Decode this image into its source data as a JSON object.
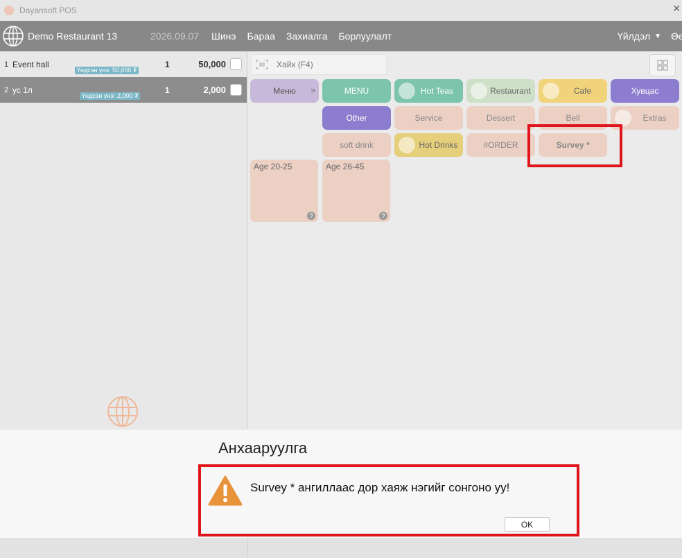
{
  "window": {
    "title": "Dayansoft POS"
  },
  "nav": {
    "restaurant": "Demo Restaurant 13",
    "date": "2026.09.07",
    "items": [
      "Шинэ",
      "Бараа",
      "Захиалга",
      "Борлуулалт"
    ],
    "operations": "Үйлдэл",
    "extra": "Өө"
  },
  "order": {
    "rows": [
      {
        "index": "1",
        "name": "Event hall",
        "badge": "Үндсэн үнэ: 50,000 ₮",
        "qty": "1",
        "price": "50,000"
      },
      {
        "index": "2",
        "name": "ус 1л",
        "badge": "Үндсэн үнэ: 2,000 ₮",
        "qty": "1",
        "price": "2,000"
      }
    ]
  },
  "search": {
    "placeholder": "Хайх (F4)"
  },
  "categories": {
    "menu_nav": "Меню",
    "menu_nav_arrow": ">",
    "row1": [
      "MENU",
      "Hot Teas",
      "Restaurant",
      "Cafe",
      "Хувцас"
    ],
    "row2": [
      "Other",
      "Service",
      "Dessert",
      "Bell",
      "Extras"
    ],
    "row3": [
      "soft drink",
      "Hot Drinks",
      "#ORDER",
      "Survey *"
    ]
  },
  "age_groups": [
    "Age 20-25",
    "Age 26-45"
  ],
  "help_mark": "?",
  "dialog": {
    "title": "Анхааруулга",
    "message": "Survey * ангиллаас дор хаяж нэгийг сонгоно уу!",
    "ok": "OK"
  },
  "colors": {
    "alert_highlight": "#e0151b",
    "warning": "#e8923a",
    "nav_bg": "#888888"
  }
}
